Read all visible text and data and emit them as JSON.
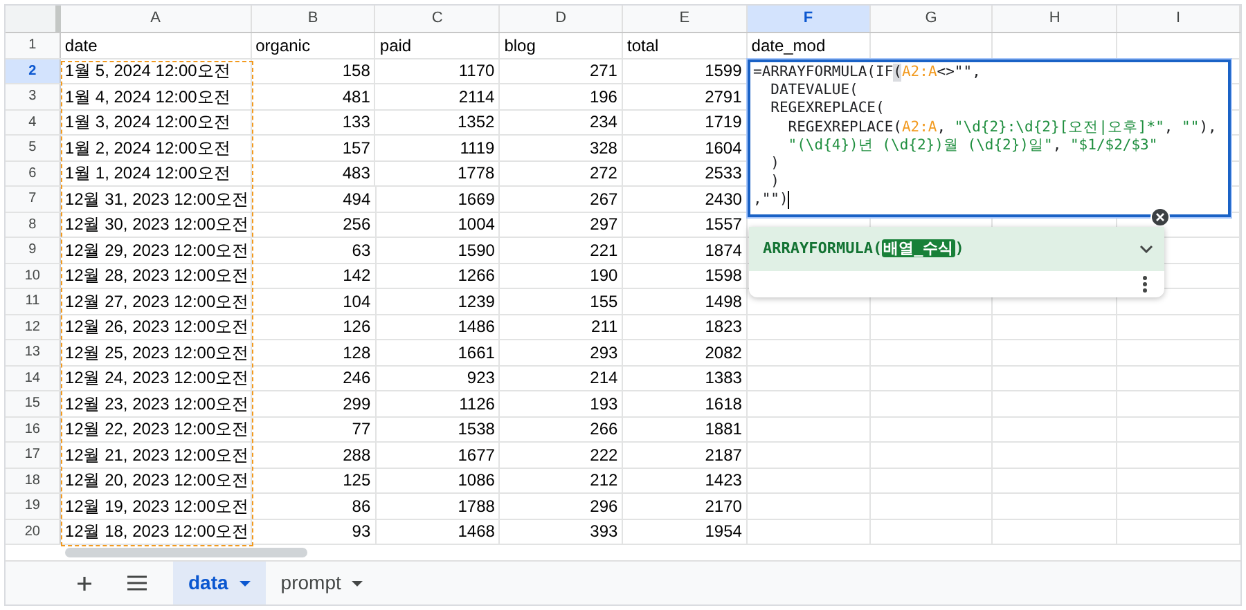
{
  "columns": [
    {
      "label": "A",
      "selected": false
    },
    {
      "label": "B",
      "selected": false
    },
    {
      "label": "C",
      "selected": false
    },
    {
      "label": "D",
      "selected": false
    },
    {
      "label": "E",
      "selected": false
    },
    {
      "label": "F",
      "selected": true
    },
    {
      "label": "G",
      "selected": false
    },
    {
      "label": "H",
      "selected": false
    },
    {
      "label": "I",
      "selected": false
    }
  ],
  "rows": [
    {
      "number": "1",
      "selected": false,
      "kind": "header",
      "cells": [
        "date",
        "organic",
        "paid",
        "blog",
        "total",
        "date_mod"
      ]
    },
    {
      "number": "2",
      "selected": true,
      "kind": "data",
      "cells": [
        "1월 5, 2024 12:00오전",
        "158",
        "1170",
        "271",
        "1599"
      ]
    },
    {
      "number": "3",
      "selected": false,
      "kind": "data",
      "cells": [
        "1월 4, 2024 12:00오전",
        "481",
        "2114",
        "196",
        "2791"
      ]
    },
    {
      "number": "4",
      "selected": false,
      "kind": "data",
      "cells": [
        "1월 3, 2024 12:00오전",
        "133",
        "1352",
        "234",
        "1719"
      ]
    },
    {
      "number": "5",
      "selected": false,
      "kind": "data",
      "cells": [
        "1월 2, 2024 12:00오전",
        "157",
        "1119",
        "328",
        "1604"
      ]
    },
    {
      "number": "6",
      "selected": false,
      "kind": "data",
      "cells": [
        "1월 1, 2024 12:00오전",
        "483",
        "1778",
        "272",
        "2533"
      ]
    },
    {
      "number": "7",
      "selected": false,
      "kind": "data",
      "cells": [
        "12월 31, 2023 12:00오전",
        "494",
        "1669",
        "267",
        "2430"
      ]
    },
    {
      "number": "8",
      "selected": false,
      "kind": "data",
      "cells": [
        "12월 30, 2023 12:00오전",
        "256",
        "1004",
        "297",
        "1557"
      ]
    },
    {
      "number": "9",
      "selected": false,
      "kind": "data",
      "cells": [
        "12월 29, 2023 12:00오전",
        "63",
        "1590",
        "221",
        "1874"
      ]
    },
    {
      "number": "10",
      "selected": false,
      "kind": "data",
      "cells": [
        "12월 28, 2023 12:00오전",
        "142",
        "1266",
        "190",
        "1598"
      ]
    },
    {
      "number": "11",
      "selected": false,
      "kind": "data",
      "cells": [
        "12월 27, 2023 12:00오전",
        "104",
        "1239",
        "155",
        "1498"
      ]
    },
    {
      "number": "12",
      "selected": false,
      "kind": "data",
      "cells": [
        "12월 26, 2023 12:00오전",
        "126",
        "1486",
        "211",
        "1823"
      ]
    },
    {
      "number": "13",
      "selected": false,
      "kind": "data",
      "cells": [
        "12월 25, 2023 12:00오전",
        "128",
        "1661",
        "293",
        "2082"
      ]
    },
    {
      "number": "14",
      "selected": false,
      "kind": "data",
      "cells": [
        "12월 24, 2023 12:00오전",
        "246",
        "923",
        "214",
        "1383"
      ]
    },
    {
      "number": "15",
      "selected": false,
      "kind": "data",
      "cells": [
        "12월 23, 2023 12:00오전",
        "299",
        "1126",
        "193",
        "1618"
      ]
    },
    {
      "number": "16",
      "selected": false,
      "kind": "data",
      "cells": [
        "12월 22, 2023 12:00오전",
        "77",
        "1538",
        "266",
        "1881"
      ]
    },
    {
      "number": "17",
      "selected": false,
      "kind": "data",
      "cells": [
        "12월 21, 2023 12:00오전",
        "288",
        "1677",
        "222",
        "2187"
      ]
    },
    {
      "number": "18",
      "selected": false,
      "kind": "data",
      "cells": [
        "12월 20, 2023 12:00오전",
        "125",
        "1086",
        "212",
        "1423"
      ]
    },
    {
      "number": "19",
      "selected": false,
      "kind": "data",
      "cells": [
        "12월 19, 2023 12:00오전",
        "86",
        "1788",
        "296",
        "2170"
      ]
    },
    {
      "number": "20",
      "selected": false,
      "kind": "data",
      "cells": [
        "12월 18, 2023 12:00오전",
        "93",
        "1468",
        "393",
        "1954"
      ]
    }
  ],
  "formula_editor": {
    "lines": [
      [
        {
          "kind": "plain",
          "text": "=ARRAYFORMULA(IF"
        },
        {
          "kind": "matched_paren",
          "text": "("
        },
        {
          "kind": "range",
          "text": "A2:A"
        },
        {
          "kind": "plain",
          "text": "<>\"\","
        }
      ],
      [
        {
          "kind": "plain",
          "text": "  DATEVALUE("
        }
      ],
      [
        {
          "kind": "plain",
          "text": "  REGEXREPLACE("
        }
      ],
      [
        {
          "kind": "plain",
          "text": "    REGEXREPLACE("
        },
        {
          "kind": "range",
          "text": "A2:A"
        },
        {
          "kind": "plain",
          "text": ", "
        },
        {
          "kind": "string",
          "text": "\"\\d{2}:\\d{2}[오전|오후]*\""
        },
        {
          "kind": "plain",
          "text": ", "
        },
        {
          "kind": "string",
          "text": "\"\""
        },
        {
          "kind": "plain",
          "text": "),"
        }
      ],
      [
        {
          "kind": "string",
          "text": "    \"(\\d{4})년 (\\d{2})월 (\\d{2})일\""
        },
        {
          "kind": "plain",
          "text": ", "
        },
        {
          "kind": "string",
          "text": "\"$1/$2/$3\""
        }
      ],
      [
        {
          "kind": "plain",
          "text": "  )"
        }
      ],
      [
        {
          "kind": "plain",
          "text": "  )"
        }
      ],
      [
        {
          "kind": "plain",
          "text": ",\"\")"
        }
      ]
    ]
  },
  "formula_hint": {
    "function": "ARRAYFORMULA(",
    "argument": "배열_수식",
    "close": ")"
  },
  "sheet_tabs": [
    {
      "label": "data",
      "selected": true
    },
    {
      "label": "prompt",
      "selected": false
    }
  ]
}
